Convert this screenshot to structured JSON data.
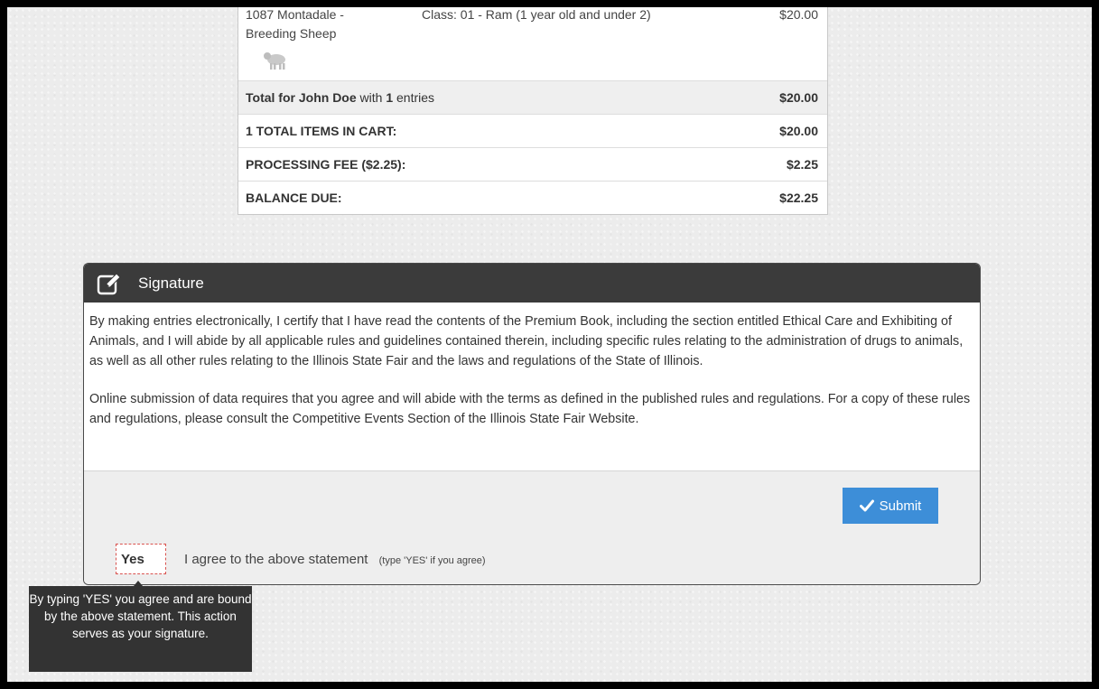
{
  "cart": {
    "entry": {
      "name": "1087 Montadale - Breeding Sheep",
      "class": "Class: 01 - Ram (1 year old and under 2)",
      "price": "$20.00",
      "icon": "sheep-icon"
    },
    "total_for": {
      "prefix": "Total for",
      "person": "John Doe",
      "middle": "with",
      "count": "1",
      "suffix": "entries",
      "amount": "$20.00"
    },
    "items_in_cart": {
      "label": "1 TOTAL ITEMS IN CART:",
      "amount": "$20.00"
    },
    "processing_fee": {
      "label": "PROCESSING FEE ($2.25):",
      "amount": "$2.25"
    },
    "balance_due": {
      "label": "BALANCE DUE:",
      "amount": "$22.25"
    }
  },
  "signature": {
    "title": "Signature",
    "icon": "edit-icon",
    "paragraph1": "By making entries electronically, I certify that I have read the contents of the Premium Book, including the section entitled Ethical Care and Exhibiting of Animals, and I will abide by all applicable rules and guidelines contained therein, including specific rules relating to the administration of drugs to animals, as well as all other rules relating to the Illinois State Fair and the laws and regulations of the State of Illinois.",
    "paragraph2": "Online submission of data requires that you agree and will abide with the terms as defined in the published rules and regulations. For a copy of these rules and regulations, please consult the Competitive Events Section of the Illinois State Fair Website.",
    "submit_label": "Submit",
    "agree_value": "Yes",
    "agree_label": "I agree to the above statement",
    "agree_hint": "(type 'YES' if you agree)",
    "tooltip": "By typing 'YES' you agree and are bound by the above statement. This action serves as your signature."
  },
  "colors": {
    "header_bg": "#3b3b3b",
    "submit_bg": "#3d8ed8",
    "input_border": "#d9534f",
    "tooltip_bg": "#333333"
  }
}
